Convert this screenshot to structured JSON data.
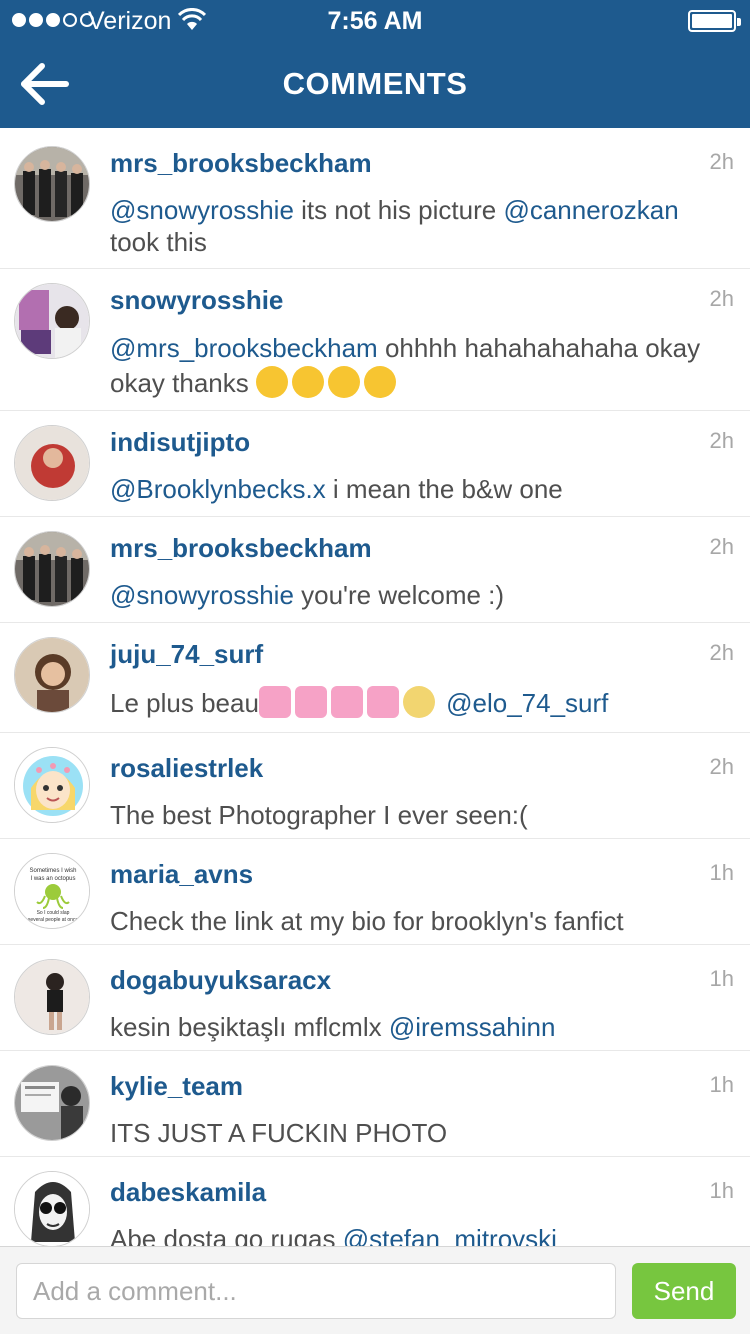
{
  "status_bar": {
    "carrier": "Verizon",
    "time": "7:56 AM",
    "signal_bars_filled": 3,
    "signal_bars_total": 5
  },
  "nav": {
    "title": "COMMENTS",
    "back_icon": "arrow-left-icon"
  },
  "colors": {
    "header": "#1e5a8e",
    "username": "#1e5a8e",
    "send": "#77c63f"
  },
  "comments": [
    {
      "username": "mrs_brooksbeckham",
      "time": "2h",
      "parts": [
        {
          "t": "@snowyrosshie",
          "m": true
        },
        {
          "t": " its not his picture "
        },
        {
          "t": "@cannerozkan",
          "m": true
        },
        {
          "t": "  took this"
        }
      ]
    },
    {
      "username": "snowyrosshie",
      "time": "2h",
      "parts": [
        {
          "t": "@mrs_brooksbeckham",
          "m": true
        },
        {
          "t": " ohhhh hahahahahaha okay okay thanks "
        }
      ],
      "emojis": [
        "heart-eyes-emoji",
        "heart-eyes-emoji",
        "smiling-face-emoji",
        "smiling-face-emoji"
      ]
    },
    {
      "username": "indisutjipto",
      "time": "2h",
      "parts": [
        {
          "t": "@Brooklynbecks.x",
          "m": true
        },
        {
          "t": " i mean the b&w one"
        }
      ]
    },
    {
      "username": "mrs_brooksbeckham",
      "time": "2h",
      "parts": [
        {
          "t": "@snowyrosshie",
          "m": true
        },
        {
          "t": " you're welcome :)"
        }
      ]
    },
    {
      "username": "juju_74_surf",
      "time": "2h",
      "parts": [
        {
          "t": "Le plus beau"
        }
      ],
      "emojis_inline": [
        "heart-arrow-emoji",
        "growing-heart-emoji",
        "heart-letter-emoji",
        "heart-ribbon-emoji",
        "scream-emoji"
      ],
      "trailing_parts": [
        {
          "t": " @elo_74_surf",
          "m": true
        }
      ]
    },
    {
      "username": "rosaliestrlek",
      "time": "2h",
      "parts": [
        {
          "t": "The best Photographer I ever seen:("
        }
      ]
    },
    {
      "username": "maria_avns",
      "time": "1h",
      "parts": [
        {
          "t": "Check the link at my bio for brooklyn's fanfict"
        }
      ]
    },
    {
      "username": "dogabuyuksaracx",
      "time": "1h",
      "parts": [
        {
          "t": "kesin beşiktaşlı mflcmlx "
        },
        {
          "t": "@iremssahinn",
          "m": true
        }
      ]
    },
    {
      "username": "kylie_team",
      "time": "1h",
      "parts": [
        {
          "t": "ITS JUST A FUCKIN PHOTO"
        }
      ]
    },
    {
      "username": "dabeskamila",
      "time": "1h",
      "parts": [
        {
          "t": "Abe dosta go rugas "
        },
        {
          "t": "@stefan_mitrovski",
          "m": true
        }
      ]
    }
  ],
  "avatar_text": {
    "maria_line1": "Sometimes I wish",
    "maria_line2": "I was an octopus",
    "maria_line3": "So I could slap",
    "maria_line4": "several people at once"
  },
  "composer": {
    "placeholder": "Add a comment...",
    "send_label": "Send"
  }
}
